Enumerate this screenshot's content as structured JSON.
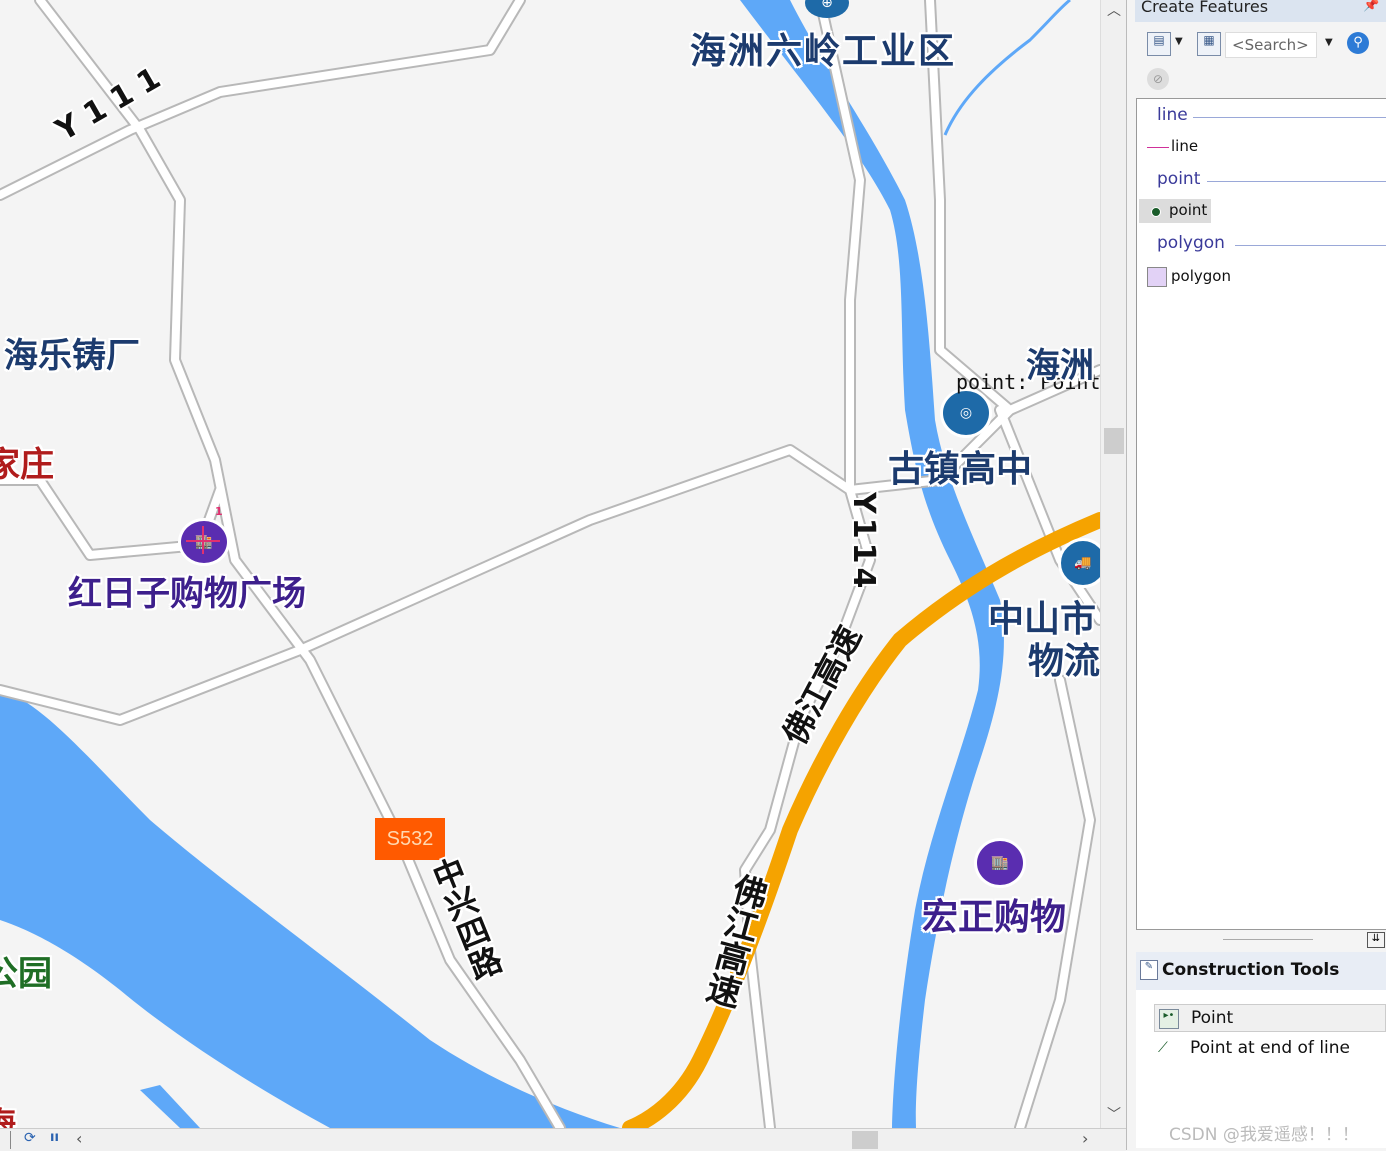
{
  "map": {
    "labels": {
      "industrial_zone": "海洲六岭工业区",
      "road_y111": "Y111",
      "foundry": "海乐铸厂",
      "village_fragment": "家庄",
      "hongrizi_mall": "红日子购物广场",
      "point_label": "point: Point",
      "haizhou_fragment": "海洲",
      "guzhen_high": "古镇高中",
      "road_y114": "Y114",
      "zhongshan_logistics_1": "中山市",
      "zhongshan_logistics_2": "物流",
      "expressway_upper": "佛江高速",
      "expressway_lower": "佛江高速",
      "route_badge": "S532",
      "zhongxing_road": "中兴四路",
      "hongzheng_shop": "宏正购物",
      "park_fragment": "公园",
      "bottom_fragment": "海"
    },
    "colors": {
      "water": "#5ea8f8",
      "expressway": "#f5a300",
      "road": "#ffffff",
      "badge": "#ff5a00",
      "background": "#f4f4f4"
    }
  },
  "statusbar": {
    "icons": [
      "refresh-icon",
      "pause-icon",
      "scroll-left-icon",
      "scroll-right-icon"
    ]
  },
  "panel": {
    "title": "Create Features",
    "search_placeholder": "<Search>",
    "groups": [
      {
        "header": "line",
        "item": "line"
      },
      {
        "header": "point",
        "item": "point"
      },
      {
        "header": "polygon",
        "item": "polygon"
      }
    ],
    "construction": {
      "title": "Construction Tools",
      "tools": [
        "Point",
        "Point at end of line"
      ]
    }
  },
  "watermark": "CSDN @我爱遥感！！！"
}
